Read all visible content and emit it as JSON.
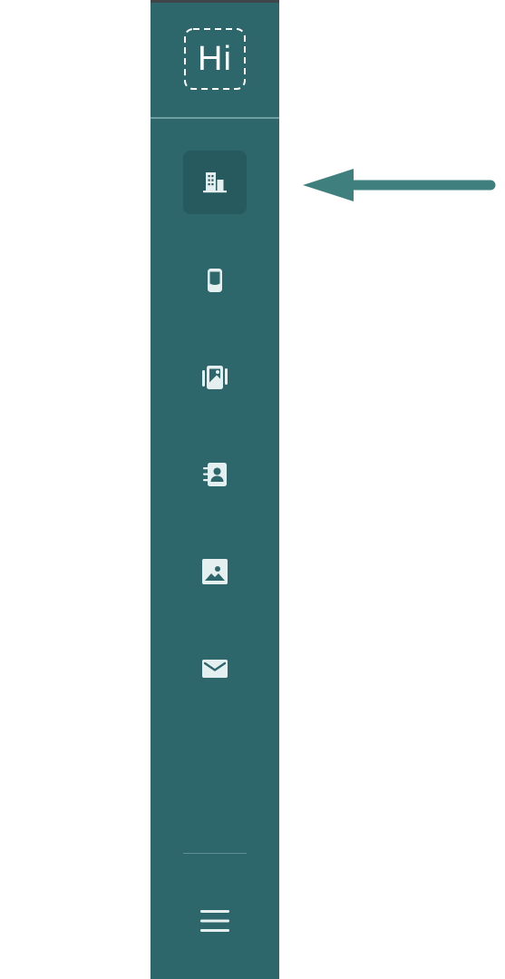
{
  "app": {
    "logo_text": "Hi"
  },
  "sidebar": {
    "items": [
      {
        "icon": "building-icon",
        "active": true
      },
      {
        "icon": "device-icon",
        "active": false
      },
      {
        "icon": "photo-album-icon",
        "active": false
      },
      {
        "icon": "contacts-icon",
        "active": false
      },
      {
        "icon": "image-icon",
        "active": false
      },
      {
        "icon": "mail-icon",
        "active": false
      }
    ],
    "menu_icon": "hamburger-menu-icon"
  },
  "annotation": {
    "icon": "arrow-left-icon",
    "color": "#3f7f7d"
  },
  "colors": {
    "sidebar_bg": "#2d676c",
    "active_bg": "#265a5e",
    "icon": "#e6efef"
  }
}
